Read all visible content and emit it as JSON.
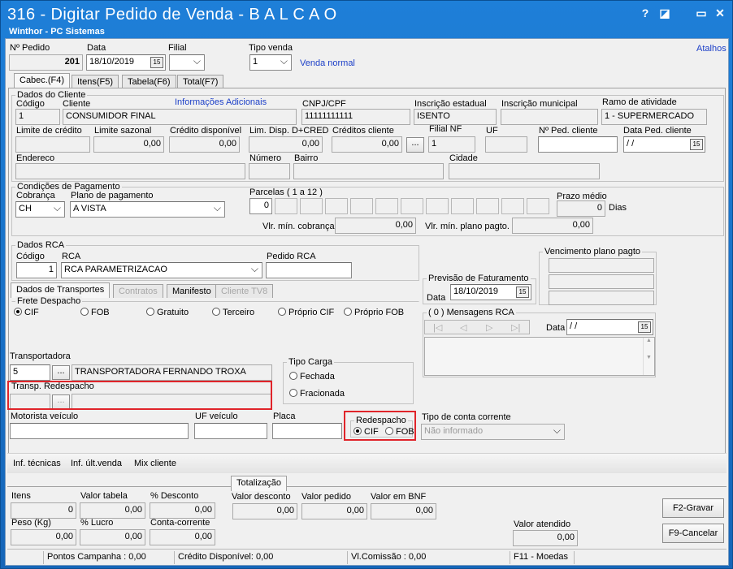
{
  "window": {
    "title": "316 - Digitar Pedido de Venda - B A L C A O",
    "subtitle": "Winthor - PC Sistemas",
    "help": "?",
    "restore": "◪",
    "min": "▭",
    "close": "✕"
  },
  "top": {
    "pedido_label": "Nº Pedido",
    "pedido": "201",
    "data_label": "Data",
    "data": "18/10/2019",
    "filial_label": "Filial",
    "filial": "",
    "tipo_label": "Tipo venda",
    "tipo": "1",
    "tipo_desc": "Venda normal",
    "atalhos": "Atalhos",
    "cal": "15"
  },
  "tabs": [
    "Cabec.(F4)",
    "Itens(F5)",
    "Tabela(F6)",
    "Total(F7)"
  ],
  "cliente": {
    "group": "Dados do Cliente",
    "codigo_label": "Código",
    "codigo": "1",
    "cliente_label": "Cliente",
    "cliente": "CONSUMIDOR FINAL",
    "info": "Informações Adicionais",
    "cnpj_label": "CNPJ/CPF",
    "cnpj": "11111111111",
    "ie_label": "Inscrição estadual",
    "ie": "ISENTO",
    "im_label": "Inscrição municipal",
    "im": "",
    "ramo_label": "Ramo de atividade",
    "ramo": "1 - SUPERMERCADO",
    "limite_label": "Limite de crédito",
    "limite": "",
    "sazonal_label": "Limite sazonal",
    "sazonal": "0,00",
    "disp_label": "Crédito disponível",
    "disp": "0,00",
    "limdisp_label": "Lim. Disp. D+CRED",
    "limdisp": "0,00",
    "credcli_label": "Créditos cliente",
    "credcli": "0,00",
    "filialnf_label": "Filial NF",
    "filialnf": "1",
    "uf_label": "UF",
    "uf": "",
    "pedcli_label": "Nº Ped. cliente",
    "pedcli": "",
    "dataped_label": "Data Ped. cliente",
    "dataped": " / /",
    "end_label": "Endereco",
    "numero_label": "Número",
    "bairro_label": "Bairro",
    "cidade_label": "Cidade",
    "dots": "..."
  },
  "pagamento": {
    "group": "Condições de Pagamento",
    "cob_label": "Cobrança",
    "cob": "CH",
    "plano_label": "Plano de pagamento",
    "plano": "A VISTA",
    "parc_label": "Parcelas ( 1 a 12 )",
    "parc_first": "0",
    "prazo_label": "Prazo médio",
    "prazo": "0",
    "dias": "Dias",
    "vlcob_label": "Vlr. mín. cobrança",
    "vlcob": "0,00",
    "vlplano_label": "Vlr. mín. plano pagto.",
    "vlplano": "0,00"
  },
  "rca": {
    "group": "Dados RCA",
    "codigo_label": "Código",
    "codigo": "1",
    "rca_label": "RCA",
    "rca": "RCA PARAMETRIZACAO",
    "pedido_label": "Pedido RCA",
    "pedido": ""
  },
  "venc": {
    "group": "Vencimento plano pagto"
  },
  "prev": {
    "group": "Previsão de Faturamento",
    "data_label": "Data",
    "data": "18/10/2019"
  },
  "subtabs": [
    "Dados de Transportes",
    "Contratos",
    "Manifesto",
    "Cliente TV8"
  ],
  "frete": {
    "group": "Frete Despacho",
    "opts": [
      "CIF",
      "FOB",
      "Gratuito",
      "Terceiro",
      "Próprio CIF",
      "Próprio FOB"
    ]
  },
  "msg": {
    "group": "( 0 ) Mensagens RCA",
    "data_label": "Data",
    "data": " / /",
    "nav": [
      "|◁",
      "◁",
      "▷",
      "▷|"
    ]
  },
  "transp": {
    "label": "Transportadora",
    "codigo": "5",
    "nome": "TRANSPORTADORA FERNANDO TROXA",
    "redesp_label": "Transp. Redespacho"
  },
  "carga": {
    "group": "Tipo Carga",
    "opts": [
      "Fechada",
      "Fracionada"
    ]
  },
  "veic": {
    "motorista_label": "Motorista veículo",
    "uf_label": "UF veículo",
    "placa_label": "Placa",
    "redesp_group": "Redespacho",
    "redesp_opts": [
      "CIF",
      "FOB"
    ],
    "conta_label": "Tipo de conta corrente",
    "conta": "Não informado"
  },
  "links": [
    "Inf. técnicas",
    "Inf. últ.venda",
    "Mix cliente"
  ],
  "tot": {
    "tab": "Totalização",
    "itens_label": "Itens",
    "itens": "0",
    "vtab_label": "Valor tabela",
    "vtab": "0,00",
    "desc_label": "% Desconto",
    "desc": "0,00",
    "vdesc_label": "Valor desconto",
    "vdesc": "0,00",
    "vped_label": "Valor pedido",
    "vped": "0,00",
    "vbnf_label": "Valor em BNF",
    "vbnf": "0,00",
    "peso_label": "Peso (Kg)",
    "peso": "0,00",
    "lucro_label": "% Lucro",
    "lucro": "0,00",
    "cc_label": "Conta-corrente",
    "cc": "0,00",
    "vat_label": "Valor atendido",
    "vat": "0,00",
    "gravar": "F2-Gravar",
    "cancelar": "F9-Cancelar"
  },
  "status": [
    "Pontos Campanha : 0,00",
    "Crédito Disponível: 0,00",
    "Vl.Comissão : 0,00",
    "F11 - Moedas"
  ],
  "colors": {
    "title": "#1a6fc4",
    "red": "#e0242a",
    "link": "#1c3fc8"
  }
}
